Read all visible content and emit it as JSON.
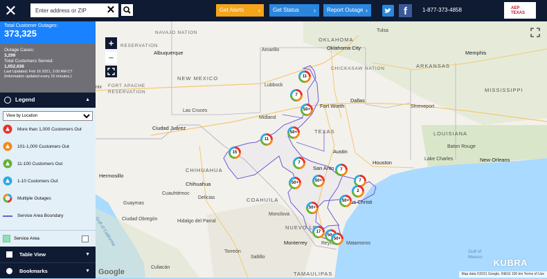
{
  "header": {
    "address_placeholder": "Enter address or ZIP",
    "get_alerts": "Get Alerts",
    "get_status": "Get Status",
    "report_outage": "Report Outage",
    "phone": "1-877-373-4858",
    "logo_line1": "AEP",
    "logo_line2": "TEXAS"
  },
  "summary": {
    "total_label": "Total Customer Outages:",
    "total_value": "373,325",
    "cases_label": "Outage Cases:",
    "cases_value": "3,299",
    "served_label": "Total Customers Served:",
    "served_value": "1,052,636",
    "updated": "Last Updated: Feb 16 2021, 2:00 AM CT",
    "update_note": "(Information updated every 15 minutes.)"
  },
  "legend": {
    "title": "Legend",
    "view_option": "View by Location",
    "items": [
      "More than 1,000 Customers Out",
      "101-1,000 Customers Out",
      "11-100 Customers Out",
      "1-10 Customers Out",
      "Multiple Outages",
      "Service Area Boundary"
    ],
    "service_area": "Service Area"
  },
  "panels": {
    "table_view": "Table View",
    "bookmarks": "Bookmarks"
  },
  "map": {
    "labels": {
      "utah_nav": "NAVAJO NATION",
      "albuquerque": "Albuquerque",
      "amarillo": "Amarillo",
      "oklahoma": "OKLAHOMA",
      "okc": "Oklahoma City",
      "tulsa": "Tulsa",
      "memphis": "Memphis",
      "arkansas": "ARKANSAS",
      "chickasaw": "CHICKASAW NATION",
      "jicarilla": "RESERVATION",
      "fort_apache": "FORT APACHE",
      "reservation2": "RESERVATION",
      "new_mexico": "NEW MEXICO",
      "lubbock": "Lubbock",
      "fort_worth": "Fort Worth",
      "dallas": "Dallas",
      "mississippi": "MISSISSIPPI",
      "las_cruces": "Las Cruces",
      "shreveport": "Shreveport",
      "ciudad_juarez": "Ciudad Juárez",
      "midland": "Midland",
      "texas": "TEXAS",
      "louisiana": "LOUISIANA",
      "austin": "Austin",
      "houston": "Houston",
      "chihuahua_state": "CHIHUAHUA",
      "san_antonio": "San Anto",
      "hermosillo": "Hermosillo",
      "chihuahua": "Chihuahua",
      "coahuila": "COAHUILA",
      "obregon": "Ciudad Obregón",
      "culiacan": "Culiacán",
      "gulf_california": "Gulf of California",
      "monterrey": "Monterrey",
      "nuevo_leon": "NUEVO LE",
      "corpus": "Corpus Christi",
      "reynosa": "Reynosa",
      "matamoros": "Matamoros",
      "tamaulipas": "TAMAULIPAS",
      "gulf_mexico_1": "Gulf of",
      "gulf_mexico_2": "Mexico",
      "new_orleans": "New Orleans",
      "lake_charles": "Lake Charles",
      "baton_rouge": "Baton Rouge",
      "ohenix": "nix",
      "torreon": "Torreón",
      "delicias": "Delicias",
      "saltillo": "Saltillo",
      "cuauhtemoc": "Cuauhtémoc",
      "guaymas": "Guaymas",
      "parral": "Hidalgo del Parral",
      "monclova": "Monclova"
    },
    "markers": [
      {
        "label": "11"
      },
      {
        "label": "7"
      },
      {
        "label": "50+"
      },
      {
        "label": "50+"
      },
      {
        "label": "11"
      },
      {
        "label": "15"
      },
      {
        "label": "7"
      },
      {
        "label": "7"
      },
      {
        "label": "50+"
      },
      {
        "label": "50+"
      },
      {
        "label": "7"
      },
      {
        "label": "2"
      },
      {
        "label": "50+"
      },
      {
        "label": "50+"
      },
      {
        "label": "17"
      },
      {
        "label": "50+"
      },
      {
        "label": "50+"
      }
    ],
    "zoom_in": "+",
    "zoom_out": "−",
    "brand": "KUBRA",
    "google": "Google",
    "attribution": "Map data ©2021 Google, INEGI   100 km   Terms of Use"
  },
  "colors": {
    "navy": "#0f1a33",
    "total_blue": "#1a82ff",
    "alerts_orange": "#f6a41a",
    "button_blue": "#2b86dd",
    "boundary": "#6b5bd0"
  }
}
